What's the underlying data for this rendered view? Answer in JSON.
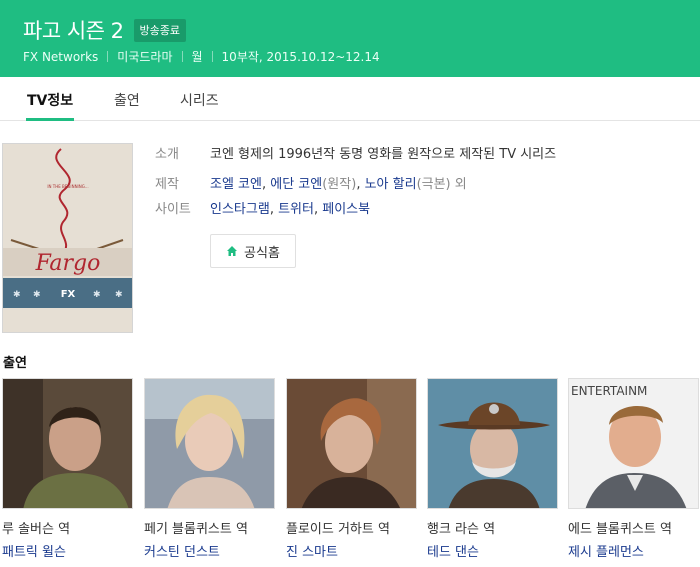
{
  "header": {
    "title": "파고 시즌 2",
    "badge": "방송종료",
    "network": "FX Networks",
    "genre": "미국드라마",
    "day": "월",
    "episodes_dates": "10부작, 2015.10.12~12.14"
  },
  "tabs": [
    {
      "label": "TV정보",
      "active": true
    },
    {
      "label": "출연",
      "active": false
    },
    {
      "label": "시리즈",
      "active": false
    }
  ],
  "info": {
    "intro_label": "소개",
    "intro_text": "코엔 형제의 1996년작 동명 영화를 원작으로 제작된 TV 시리즈",
    "production_label": "제작",
    "production_name1": "조엘 코엔",
    "production_name2": "에단 코엔",
    "production_role1": "(원작)",
    "production_name3": "노아 할리",
    "production_role2": "(극본) 외",
    "site_label": "사이트",
    "site_links": [
      "인스타그램",
      "트위터",
      "페이스북"
    ],
    "home_button": "공식홈"
  },
  "poster": {
    "text_top": "IN THE BEGINNING...",
    "logo": "Fargo",
    "fx": "FX"
  },
  "cast": {
    "heading": "출연",
    "items": [
      {
        "role": "루 솔버슨 역",
        "actor": "패트릭 윌슨"
      },
      {
        "role": "페기 블롬퀴스트 역",
        "actor": "커스틴 던스트"
      },
      {
        "role": "플로이드 거하트 역",
        "actor": "진 스마트"
      },
      {
        "role": "행크 라슨 역",
        "actor": "테드 댄슨"
      },
      {
        "role": "에드 블롬퀴스트 역",
        "actor": "제시 플레먼스",
        "photo_text": "ENTERTAINM"
      }
    ]
  },
  "colors": {
    "brand": "#1fbd82",
    "link": "#1a3a8e"
  }
}
